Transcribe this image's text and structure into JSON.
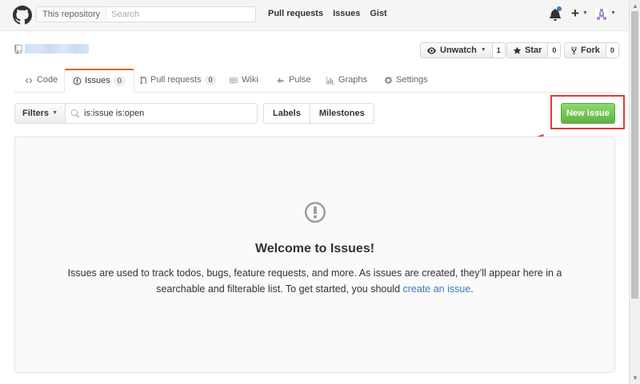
{
  "header": {
    "search_scope": "This repository",
    "search_placeholder": "Search",
    "nav": [
      "Pull requests",
      "Issues",
      "Gist"
    ]
  },
  "repo": {
    "watch_label": "Unwatch",
    "watch_count": "1",
    "star_label": "Star",
    "star_count": "0",
    "fork_label": "Fork",
    "fork_count": "0"
  },
  "tabs": [
    {
      "label": "Code",
      "icon": "code-icon"
    },
    {
      "label": "Issues",
      "icon": "issue-opened-icon",
      "counter": "0",
      "selected": true
    },
    {
      "label": "Pull requests",
      "icon": "git-pull-request-icon",
      "counter": "0"
    },
    {
      "label": "Wiki",
      "icon": "book-icon"
    },
    {
      "label": "Pulse",
      "icon": "pulse-icon"
    },
    {
      "label": "Graphs",
      "icon": "graph-icon"
    },
    {
      "label": "Settings",
      "icon": "gear-icon"
    }
  ],
  "subnav": {
    "filters_label": "Filters",
    "query": "is:issue is:open",
    "labels": "Labels",
    "milestones": "Milestones",
    "new_issue": "New issue"
  },
  "blankslate": {
    "title": "Welcome to Issues!",
    "text_before": "Issues are used to track todos, bugs, feature requests, and more. As issues are created, they’ll appear here in a searchable and filterable list. To get started, you should ",
    "link": "create an issue",
    "text_after": "."
  },
  "colors": {
    "accent_orange": "#d26911",
    "new_issue_green": "#60b044",
    "highlight_red": "#e53935",
    "link_blue": "#4078c0"
  }
}
